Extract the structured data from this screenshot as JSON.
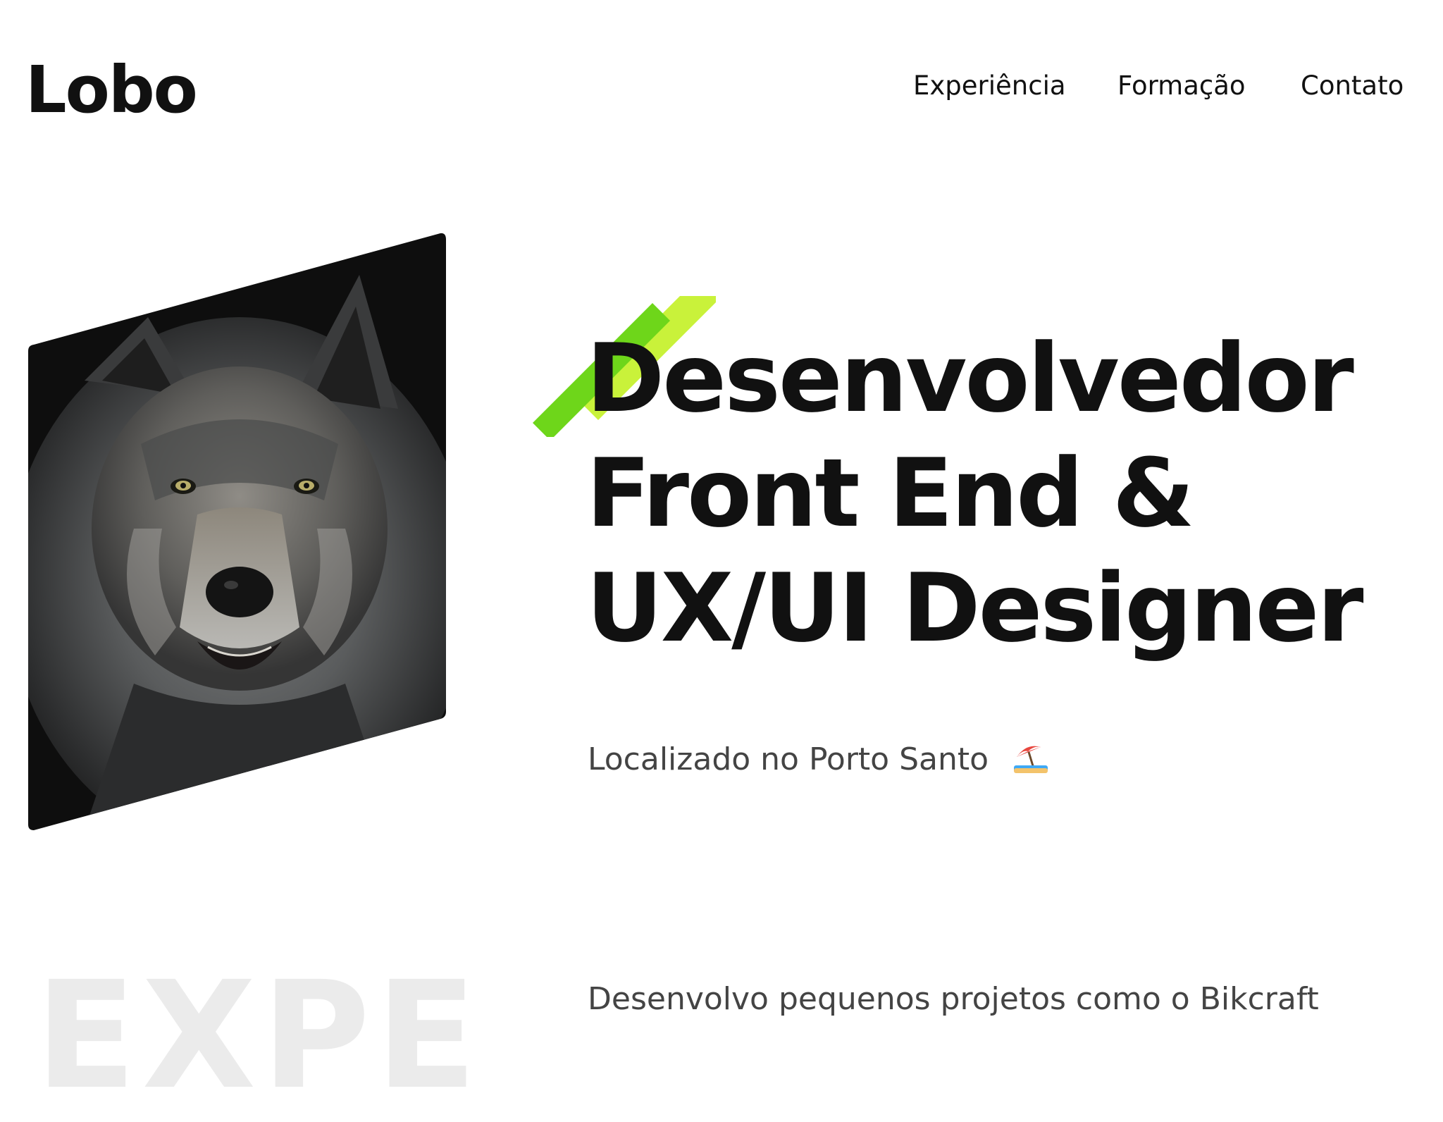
{
  "header": {
    "logo": "Lobo",
    "nav": [
      {
        "label": "Experiência"
      },
      {
        "label": "Formação"
      },
      {
        "label": "Contato"
      }
    ]
  },
  "hero": {
    "image_subject": "wolf portrait",
    "title_lines": [
      "Desenvolvedor",
      "Front End &",
      "UX/UI Designer"
    ],
    "location": "Localizado no Porto Santo",
    "location_icon": "beach-umbrella-emoji"
  },
  "experience": {
    "watermark": "EXPE",
    "intro": "Desenvolvo pequenos projetos como o Bikcraft"
  },
  "colors": {
    "text": "#111111",
    "muted_text": "#444444",
    "accent_green": "#6ed61a",
    "accent_lime": "#c9f23a",
    "watermark": "#ebebeb",
    "background": "#ffffff"
  }
}
